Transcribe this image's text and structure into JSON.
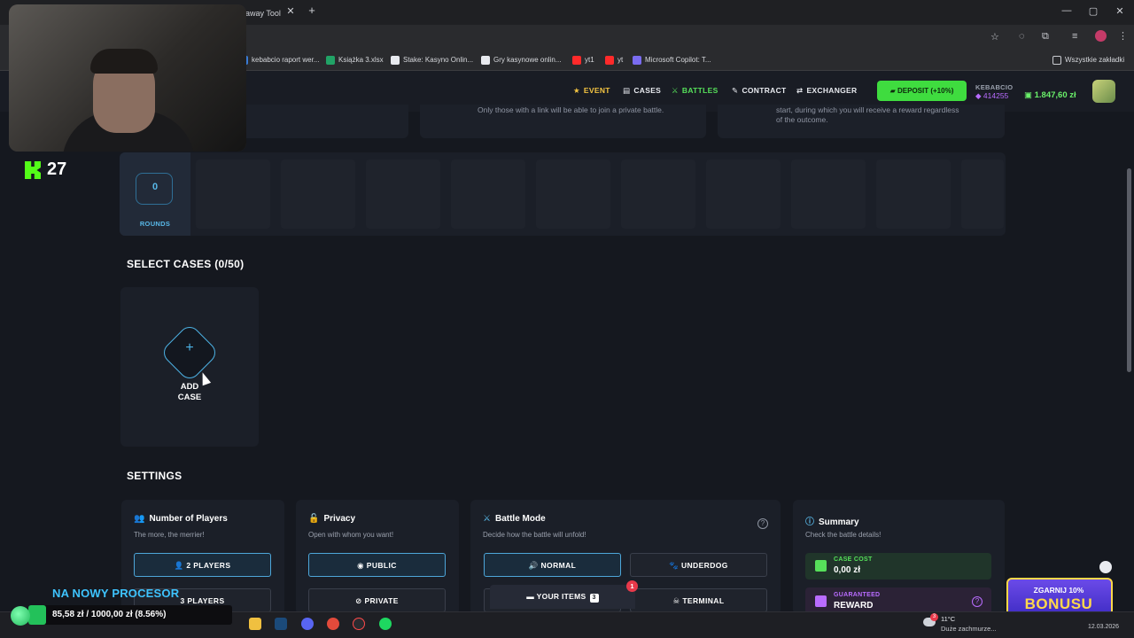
{
  "browser": {
    "tab_title": "eaway Tool",
    "new_tab_symbol": "+",
    "close_symbol": "✕",
    "bookmarks": [
      {
        "label": "kebabcio raport wer...",
        "color": "#3a7bd5"
      },
      {
        "label": "Książka 3.xlsx",
        "color": "#21a366"
      },
      {
        "label": "Stake: Kasyno Onlin...",
        "color": "#ffffff"
      },
      {
        "label": "Gry kasynowe onlin...",
        "color": "#ffffff"
      },
      {
        "label": "yt1",
        "color": "#ff2a2a"
      },
      {
        "label": "yt",
        "color": "#ff2a2a"
      },
      {
        "label": "Microsoft Copilot: T...",
        "color": "#7a6cf0"
      }
    ],
    "all_bookmarks": "Wszystkie zakładki"
  },
  "nav": {
    "event": "EVENT",
    "cases": "CASES",
    "battles": "BATTLES",
    "contract": "CONTRACT",
    "exchanger": "EXCHANGER",
    "deposit": "DEPOSIT (+10%)",
    "username": "KEBABCIO",
    "points": "414255",
    "balance": "1.847,60 zł"
  },
  "info": {
    "privacy_text": "Only those with a link will be able to join a private battle.",
    "mode_text_1": "start, during which you will receive a reward regardless",
    "mode_text_2": "of the outcome."
  },
  "overlay": {
    "kick_count": "27",
    "goal_title": "NA NOWY PROCESOR",
    "goal_text": "85,58 zł / 1000,00 zł (8.56%)",
    "goal_progress": 0.0856,
    "promo_line1": "ZGARNIJ 10%",
    "promo_line2": "BONUSU"
  },
  "rounds": {
    "count": "0",
    "label": "ROUNDS"
  },
  "select_cases": {
    "title": "SELECT CASES (0/50)",
    "add_label_1": "ADD",
    "add_label_2": "CASE",
    "plus": "+"
  },
  "settings": {
    "title": "SETTINGS",
    "players": {
      "title": "Number of Players",
      "subtitle": "The more, the merrier!",
      "option1": "2 PLAYERS",
      "option2": "3 PLAYERS"
    },
    "privacy": {
      "title": "Privacy",
      "subtitle": "Open with whom you want!",
      "option1": "PUBLIC",
      "option2": "PRIVATE"
    },
    "battle_mode": {
      "title": "Battle Mode",
      "subtitle": "Decide how the battle will unfold!",
      "option1": "NORMAL",
      "option2": "UNDERDOG",
      "option3": "TERMINAL",
      "help": "?"
    },
    "summary": {
      "title": "Summary",
      "subtitle": "Check the battle details!",
      "cost_label": "CASE COST",
      "cost_value": "0,00 zł",
      "reward_label": "GUARANTEED",
      "reward_value": "REWARD"
    }
  },
  "your_items": {
    "label": "YOUR ITEMS",
    "count": "3",
    "notification": "1"
  },
  "taskbar": {
    "weather_temp": "11°C",
    "weather_desc": "Duże zachmurze...",
    "date": "12.03.2026",
    "notif_count": "3"
  }
}
